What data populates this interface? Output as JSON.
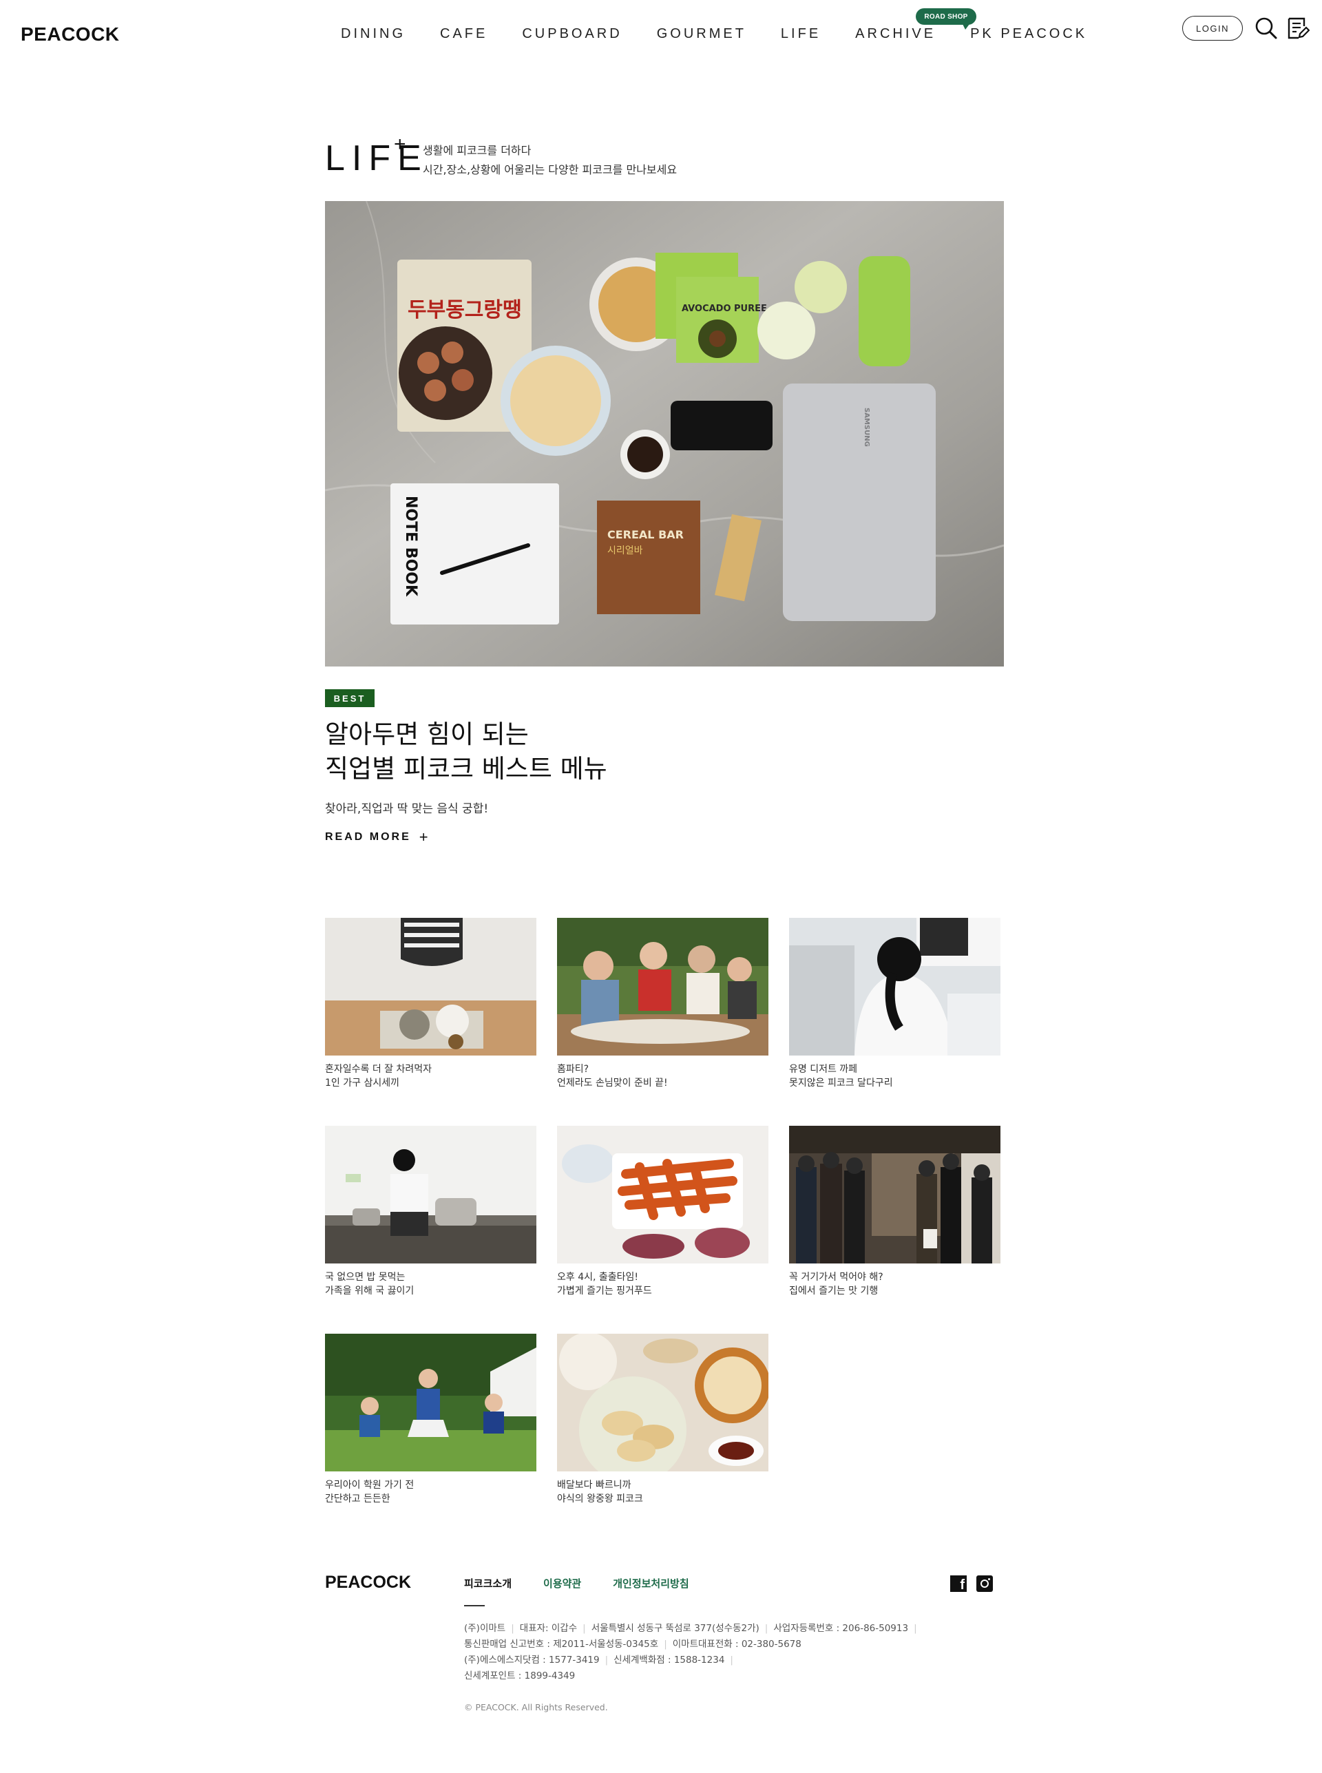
{
  "header": {
    "logo": "PEACOCK",
    "nav": [
      "DINING",
      "CAFE",
      "CUPBOARD",
      "GOURMET",
      "LIFE",
      "ARCHIVE",
      "PK PEACOCK"
    ],
    "roadshop_badge": "ROAD SHOP",
    "login_label": "LOGIN"
  },
  "section": {
    "title": "LIFE",
    "plus": "+",
    "desc_line1": "생활에 피코크를 더하다",
    "desc_line2": "시간,장소,상황에 어울리는 다양한 피코크를 만나보세요"
  },
  "hero": {
    "badge": "BEST",
    "title_line1": "알아두면 힘이 되는",
    "title_line2": "직업별 피코크 베스트 메뉴",
    "subtitle": "찾아라,직업과 딱 맞는 음식 궁합!",
    "readmore": "READ MORE",
    "readmore_plus": "+",
    "image_text": {
      "pack": "두부동그랑땡",
      "notebook": "NOTE BOOK",
      "cereal": "CEREAL BAR",
      "cereal_kr": "시리얼바",
      "avocado": "AVOCADO PUREE",
      "laptop": "SAMSUNG"
    }
  },
  "cards": [
    {
      "line1": "혼자일수록 더 잘 차려먹자",
      "line2": "1인 가구 삼시세끼"
    },
    {
      "line1": "홈파티?",
      "line2": "언제라도 손님맞이 준비 끝!"
    },
    {
      "line1": "유명 디저트 까페",
      "line2": "못지않은 피코크 달다구리"
    },
    {
      "line1": "국 없으면 밥 못먹는",
      "line2": "가족을 위해 국 끓이기"
    },
    {
      "line1": "오후 4시, 출출타임!",
      "line2": "가볍게 즐기는 핑거푸드"
    },
    {
      "line1": "꼭 거기가서 먹어야 해?",
      "line2": "집에서 즐기는 맛 기행"
    },
    {
      "line1": "우리아이 학원 가기 전",
      "line2": "간단하고 든든한"
    },
    {
      "line1": "배달보다 빠르니까",
      "line2": "야식의 왕중왕 피코크"
    }
  ],
  "footer": {
    "logo": "PEACOCK",
    "links": [
      "피코크소개",
      "이용약관",
      "개인정보처리방침"
    ],
    "info_line1": [
      "(주)이마트",
      "대표자: 이갑수",
      "서울특별시 성동구 뚝섬로 377(성수동2가)",
      "사업자등록번호 : 206-86-50913"
    ],
    "info_line2": [
      "통신판매업 신고번호 : 제2011-서울성동-0345호",
      "이마트대표전화 : 02-380-5678"
    ],
    "info_line3": [
      "(주)에스에스지닷컴 : 1577-3419",
      "신세계백화점 : 1588-1234"
    ],
    "info_line4": "신세계포인트 : 1899-4349",
    "copyright": "© PEACOCK. All Rights Reserved.",
    "sns": [
      "facebook-icon",
      "instagram-icon"
    ],
    "colors": {
      "accent": "#1e6b4a",
      "best": "#1b5e20"
    }
  }
}
